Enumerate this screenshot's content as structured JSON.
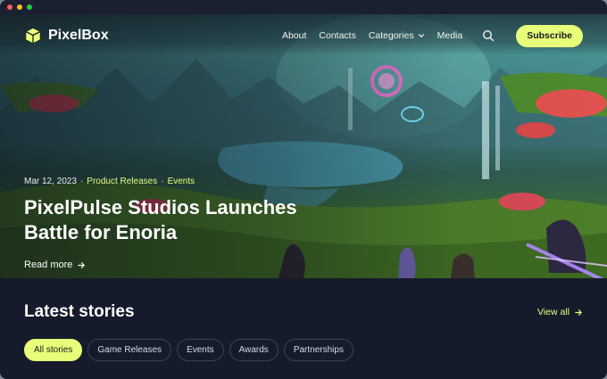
{
  "brand": {
    "name": "PixelBox"
  },
  "nav": {
    "links": [
      "About",
      "Contacts",
      "Categories",
      "Media"
    ],
    "subscribe_label": "Subscribe"
  },
  "hero": {
    "date": "Mar 12, 2023",
    "separator": "·",
    "tags": [
      "Product Releases",
      "Events"
    ],
    "title": "PixelPulse Studios Launches Battle for Enoria",
    "read_more": "Read more"
  },
  "latest": {
    "title": "Latest stories",
    "view_all": "View all",
    "filters": [
      "All stories",
      "Game Releases",
      "Events",
      "Awards",
      "Partnerships"
    ],
    "active_filter": "All stories"
  },
  "colors": {
    "accent": "#e8ff7a",
    "background": "#161b2b"
  },
  "icons": [
    "cube-logo-icon",
    "chevron-down-icon",
    "search-icon",
    "arrow-right-icon"
  ]
}
